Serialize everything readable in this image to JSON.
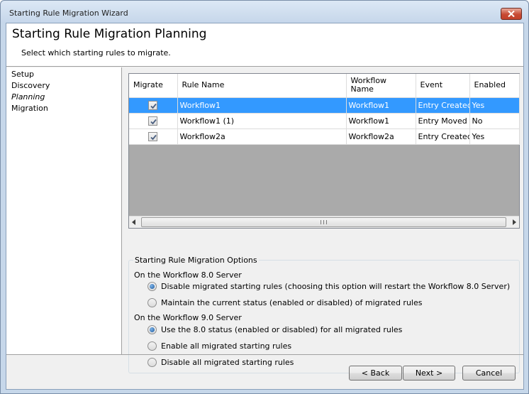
{
  "window": {
    "title": "Starting Rule Migration Wizard"
  },
  "header": {
    "title": "Starting Rule Migration Planning",
    "subtitle": "Select which starting rules to migrate."
  },
  "steps": [
    "Setup",
    "Discovery",
    "Planning",
    "Migration"
  ],
  "current_step": "Planning",
  "grid": {
    "columns": [
      "Migrate",
      "Rule Name",
      "Workflow Name",
      "Event",
      "Enabled"
    ],
    "rows": [
      {
        "migrate": true,
        "rule_name": "Workflow1",
        "workflow_name": "Workflow1",
        "event": "Entry Created",
        "enabled": "Yes",
        "selected": true
      },
      {
        "migrate": true,
        "rule_name": "Workflow1 (1)",
        "workflow_name": "Workflow1",
        "event": "Entry Moved",
        "enabled": "No",
        "selected": false
      },
      {
        "migrate": true,
        "rule_name": "Workflow2a",
        "workflow_name": "Workflow2a",
        "event": "Entry Created",
        "enabled": "Yes",
        "selected": false
      }
    ]
  },
  "options": {
    "legend": "Starting Rule Migration Options",
    "server8": {
      "heading": "On the Workflow 8.0 Server",
      "choices": [
        {
          "label": "Disable migrated starting rules (choosing this option will restart the Workflow 8.0 Server)",
          "checked": true
        },
        {
          "label": "Maintain the current status (enabled or disabled) of migrated rules",
          "checked": false
        }
      ]
    },
    "server9": {
      "heading": "On the Workflow 9.0 Server",
      "choices": [
        {
          "label": "Use the 8.0 status (enabled or disabled) for all migrated rules",
          "checked": true
        },
        {
          "label": "Enable all migrated starting rules",
          "checked": false
        },
        {
          "label": "Disable all migrated starting rules",
          "checked": false
        }
      ]
    }
  },
  "buttons": {
    "back": "< Back",
    "next": "Next >",
    "cancel": "Cancel"
  },
  "colors": {
    "selection": "#3399ff",
    "titlebar": "#c6d7ea",
    "close": "#c74a34"
  }
}
